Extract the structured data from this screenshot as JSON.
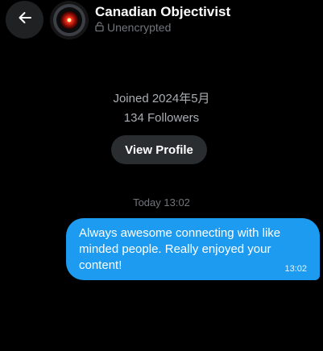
{
  "header": {
    "back_icon": "arrow-left-icon",
    "name": "Canadian Objectivist",
    "encryption_icon": "lock-icon",
    "encryption_status": "Unencrypted"
  },
  "profile": {
    "joined": "Joined 2024年5月",
    "followers": "134 Followers",
    "view_profile_label": "View Profile"
  },
  "conversation": {
    "date_divider": "Today 13:02",
    "messages": [
      {
        "text": "Always awesome connecting with like minded people. Really enjoyed your content!",
        "time": "13:02",
        "sender": "self"
      }
    ]
  },
  "colors": {
    "bubble": "#1d9bf0",
    "background": "#000000"
  }
}
